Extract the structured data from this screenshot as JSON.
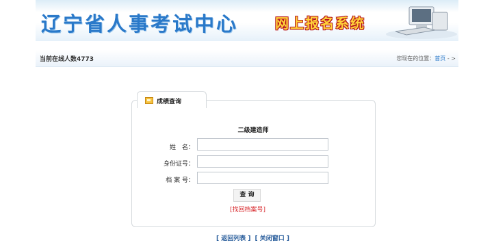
{
  "header": {
    "site_title": "辽宁省人事考试中心",
    "system_title": "网上报名系统"
  },
  "status": {
    "online_count": "当前在线人数4773",
    "location_prefix": "您现在的位置：",
    "location_home": "首页",
    "location_suffix": " - >"
  },
  "panel": {
    "tab_label": "成绩查询",
    "exam_name": "二级建造师",
    "fields": {
      "name_label": "姓　名：",
      "id_label": "身份证号：",
      "file_label": "档 案 号："
    },
    "query_button": "查 询",
    "recover_link": "[找回档案号]"
  },
  "footer": {
    "back_link": "[ 返回列表 ]",
    "close_link": "[ 关闭窗口 ]"
  }
}
